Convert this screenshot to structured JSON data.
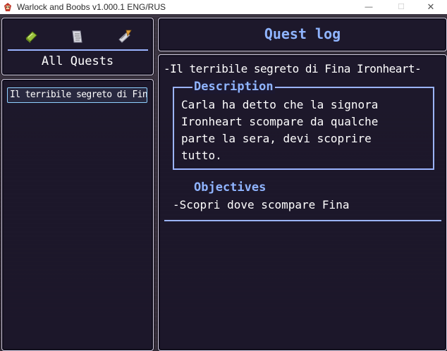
{
  "window": {
    "title": "Warlock and Boobs v1.000.1 ENG/RUS",
    "buttons": {
      "minimize": "—",
      "maximize": "☐",
      "close": "✕"
    }
  },
  "categories": {
    "icons": [
      "book-icon",
      "scroll-icon",
      "quill-scroll-icon"
    ],
    "selected_label": "All Quests"
  },
  "quest_list": {
    "items": [
      "Il terribile segreto di Fina Ironheart"
    ]
  },
  "header": {
    "title": "Quest log"
  },
  "detail": {
    "quest_name": "-Il terribile segreto di Fina Ironheart-",
    "description_label": "Description",
    "description_lines": [
      "Carla ha detto che la signora",
      "Ironheart scompare da qualche",
      "parte la sera, devi scoprire",
      "tutto."
    ],
    "objectives_label": "Objectives",
    "objectives": [
      "-Scopri dove scompare Fina"
    ]
  },
  "colors": {
    "accent": "#8fb4ff",
    "panel": "#181428",
    "text": "#ffffff"
  }
}
